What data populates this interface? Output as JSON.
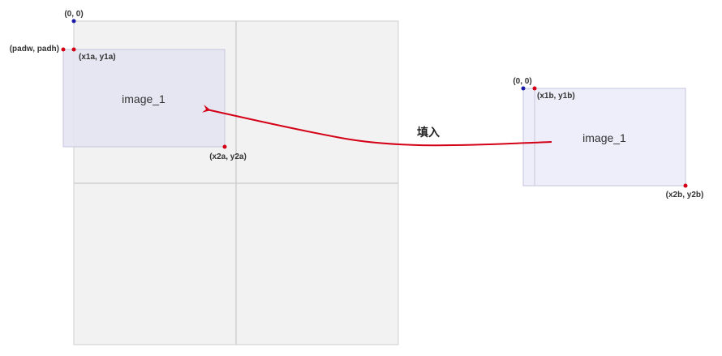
{
  "colors": {
    "canvas_fill": "#f2f2f2",
    "canvas_stroke": "#cfcfcf",
    "image_a_fill": "#e4e4f2",
    "image_b_fill": "#eeeefa",
    "image_stroke": "#c6c6dc",
    "dot_red": "#d40016",
    "dot_blue": "#1a1aa8",
    "arrow": "#d40016"
  },
  "labels": {
    "origin_a": "(0, 0)",
    "pad": "(padw, padh)",
    "a_top_left": "(x1a,  y1a)",
    "a_bottom_right": "(x2a, y2a)",
    "image_a": "image_1",
    "origin_b": "(0, 0)",
    "b_top_left": "(x1b,  y1b)",
    "b_bottom_right": "(x2b, y2b)",
    "image_b": "image_1",
    "arrow": "填入"
  }
}
